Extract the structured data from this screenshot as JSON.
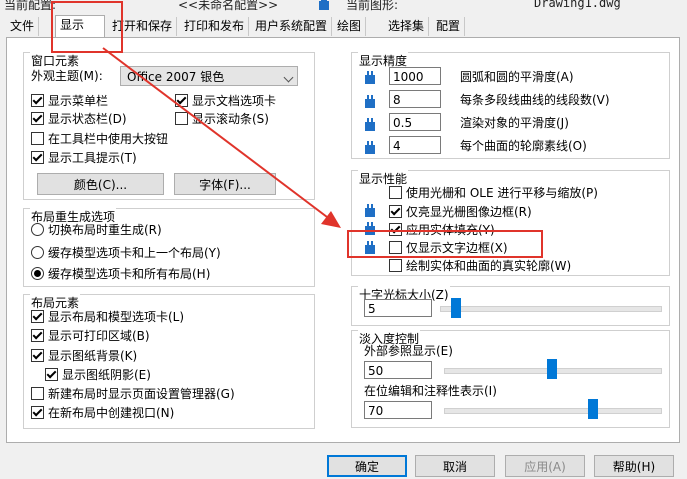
{
  "header": {
    "profile_label": "当前配置:",
    "profile_value": "<<未命名配置>>",
    "drawing_label": "当前图形:",
    "drawing_value": "Drawing1.dwg"
  },
  "tabs": [
    "文件",
    "显示",
    "打开和保存",
    "打印和发布",
    "用户系统配置",
    "绘图",
    "选择集",
    "配置"
  ],
  "window": {
    "title": "窗口元素",
    "theme_label": "外观主题(M):",
    "theme_value": "Office 2007 银色",
    "checks": [
      {
        "label": "显示菜单栏",
        "checked": true
      },
      {
        "label": "显示文档选项卡",
        "checked": true
      },
      {
        "label": "显示状态栏(D)",
        "checked": true
      },
      {
        "label": "显示滚动条(S)",
        "checked": false
      },
      {
        "label": "在工具栏中使用大按钮",
        "checked": false
      },
      {
        "label": "显示工具提示(T)",
        "checked": true
      }
    ],
    "color_button": "颜色(C)...",
    "font_button": "字体(F)..."
  },
  "layout_regen": {
    "title": "布局重生成选项",
    "options": [
      {
        "label": "切换布局时重生成(R)",
        "selected": false
      },
      {
        "label": "缓存模型选项卡和上一个布局(Y)",
        "selected": false
      },
      {
        "label": "缓存模型选项卡和所有布局(H)",
        "selected": true
      }
    ]
  },
  "layout_elements": {
    "title": "布局元素",
    "checks": [
      {
        "label": "显示布局和模型选项卡(L)",
        "checked": true
      },
      {
        "label": "显示可打印区域(B)",
        "checked": true
      },
      {
        "label": "显示图纸背景(K)",
        "checked": true
      },
      {
        "label": "显示图纸阴影(E)",
        "checked": true
      },
      {
        "label": "新建布局时显示页面设置管理器(G)",
        "checked": false
      },
      {
        "label": "在新布局中创建视口(N)",
        "checked": true
      }
    ]
  },
  "precision": {
    "title": "显示精度",
    "items": [
      {
        "value": "1000",
        "label": "圆弧和圆的平滑度(A)"
      },
      {
        "value": "8",
        "label": "每条多段线曲线的线段数(V)"
      },
      {
        "value": "0.5",
        "label": "渲染对象的平滑度(J)"
      },
      {
        "value": "4",
        "label": "每个曲面的轮廓素线(O)"
      }
    ]
  },
  "performance": {
    "title": "显示性能",
    "checks": [
      {
        "label": "使用光栅和 OLE 进行平移与缩放(P)",
        "checked": false
      },
      {
        "label": "仅亮显光栅图像边框(R)",
        "checked": true
      },
      {
        "label": "应用实体填充(Y)",
        "checked": true
      },
      {
        "label": "仅显示文字边框(X)",
        "checked": false
      },
      {
        "label": "绘制实体和曲面的真实轮廓(W)",
        "checked": false
      }
    ]
  },
  "crosshair": {
    "title": "十字光标大小(Z)",
    "value": "5",
    "level_percent": 5
  },
  "fade": {
    "title": "淡入度控制",
    "xref_label": "外部参照显示(E)",
    "xref_value": "50",
    "xref_percent": 50,
    "inplace_label": "在位编辑和注释性表示(I)",
    "inplace_value": "70",
    "inplace_percent": 70
  },
  "footer": {
    "ok": "确定",
    "cancel": "取消",
    "apply": "应用(A)",
    "help": "帮助(H)"
  },
  "colors": {
    "annotation": "#e0342b",
    "slider_thumb": "#0078d7",
    "db_icon": "#1f6fc5"
  }
}
